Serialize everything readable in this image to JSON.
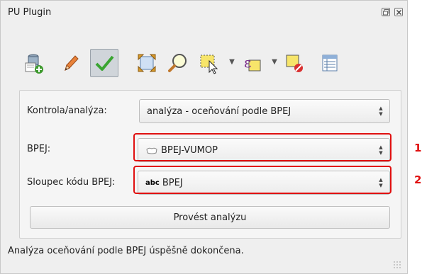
{
  "window": {
    "title": "PU Plugin"
  },
  "toolbar": {
    "icons": [
      "database-add-icon",
      "pencil-icon",
      "checkmark-icon",
      "zoom-extent-icon",
      "zoom-magnifier-icon",
      "select-features-icon",
      "dropdown-arrow-icon",
      "expression-select-icon",
      "dropdown-arrow-icon",
      "clear-selection-icon",
      "attribute-table-icon"
    ],
    "active": "checkmark-icon"
  },
  "form": {
    "kontrola_label": "Kontrola/analýza:",
    "kontrola_value": "analýza - oceňování podle BPEJ",
    "bpej_label": "BPEJ:",
    "bpej_value": "BPEJ-VUMOP",
    "sloupec_label": "Sloupec kódu BPEJ:",
    "sloupec_type": "abc",
    "sloupec_value": "BPEJ",
    "run_button": "Provést analýzu"
  },
  "annotations": {
    "marker1": "1",
    "marker2": "2",
    "color": "#e01010"
  },
  "status": {
    "message": "Analýza oceňování podle BPEJ úspěšně dokončena."
  }
}
